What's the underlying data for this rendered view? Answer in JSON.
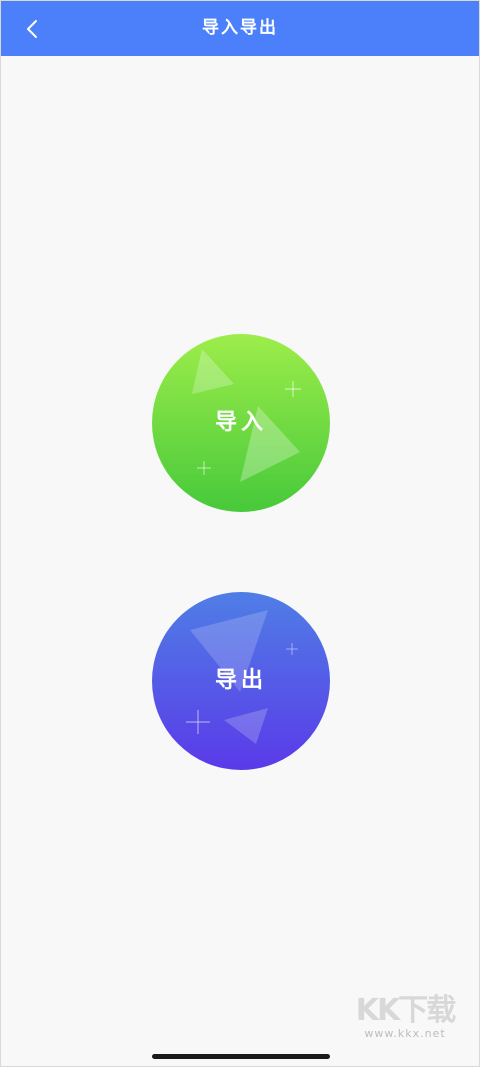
{
  "nav": {
    "title": "导入导出",
    "back_icon": "chevron-left-icon"
  },
  "actions": {
    "import_label": "导入",
    "export_label": "导出"
  },
  "watermark": {
    "logo": "KK下载",
    "url": "www.kkx.net"
  },
  "colors": {
    "nav_bg": "#4c80fb",
    "import_gradient": [
      "#9ded4a",
      "#47c93a"
    ],
    "export_gradient": [
      "#4f7ee6",
      "#5a3ae8"
    ],
    "background": "#f8f8f8"
  }
}
